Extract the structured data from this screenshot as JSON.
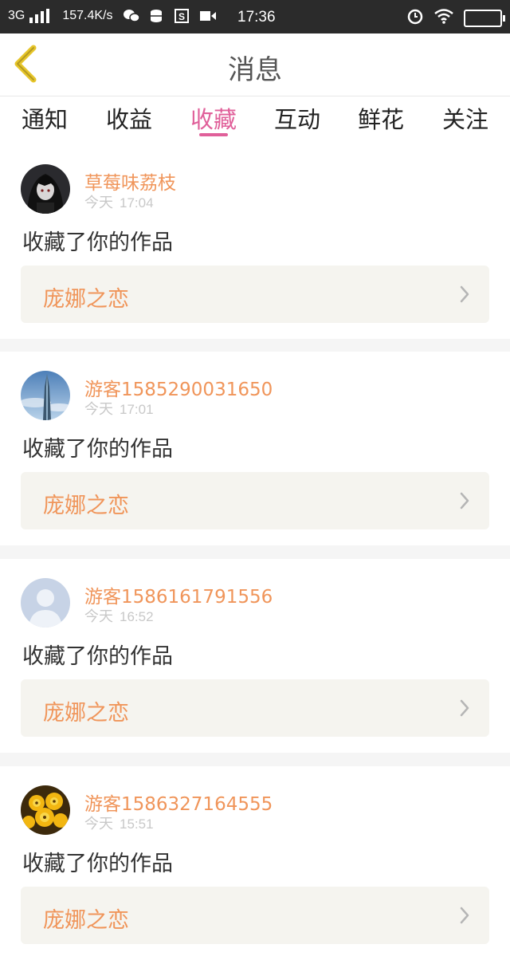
{
  "status_bar": {
    "network": "3G",
    "speed": "157.4K/s",
    "time": "17:36",
    "icons": [
      "wechat-icon",
      "database-icon",
      "s-app-icon",
      "video-icon",
      "alarm-icon",
      "wifi-icon",
      "battery-icon"
    ]
  },
  "header": {
    "title": "消息"
  },
  "tabs": [
    {
      "label": "通知",
      "active": false
    },
    {
      "label": "收益",
      "active": false
    },
    {
      "label": "收藏",
      "active": true
    },
    {
      "label": "互动",
      "active": false
    },
    {
      "label": "鲜花",
      "active": false
    },
    {
      "label": "关注",
      "active": false
    }
  ],
  "feed": [
    {
      "username": "草莓味荔枝",
      "day": "今天",
      "time": "17:04",
      "action": "收藏了你的作品",
      "work": "庞娜之恋",
      "avatar": "dark-anime-avatar"
    },
    {
      "username": "游客1585290031650",
      "day": "今天",
      "time": "17:01",
      "action": "收藏了你的作品",
      "work": "庞娜之恋",
      "avatar": "sky-tower-avatar"
    },
    {
      "username": "游客1586161791556",
      "day": "今天",
      "time": "16:52",
      "action": "收藏了你的作品",
      "work": "庞娜之恋",
      "avatar": "default-user-avatar"
    },
    {
      "username": "游客1586327164555",
      "day": "今天",
      "time": "15:51",
      "action": "收藏了你的作品",
      "work": "庞娜之恋",
      "avatar": "yellow-flower-avatar"
    }
  ],
  "colors": {
    "accent_pink": "#e0609a",
    "username_orange": "#f0955a",
    "back_yellow": "#e6c52a"
  }
}
